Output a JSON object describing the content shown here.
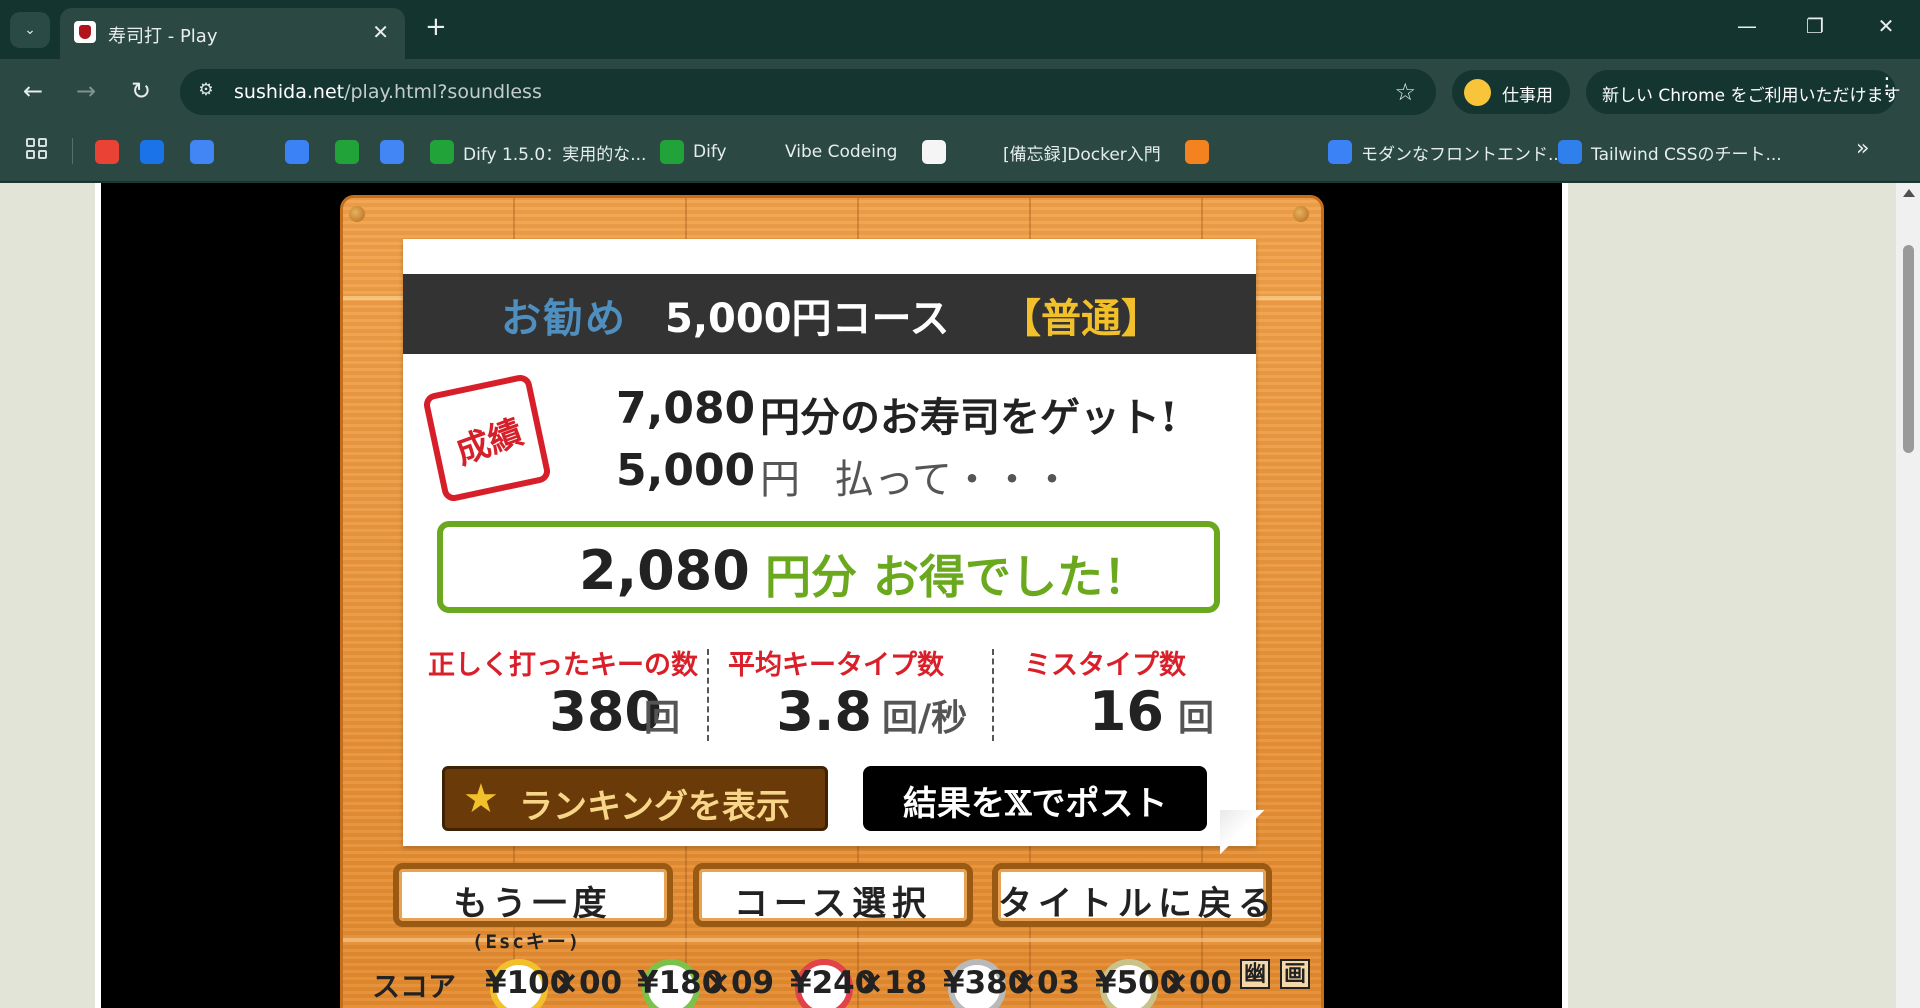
{
  "browser": {
    "tab_title": "寿司打 - Play",
    "url_host": "sushida.net",
    "url_rest": "/play.html?soundless",
    "profile_label": "仕事用",
    "chrome_promo": "新しい Chrome をご利用いただけます",
    "colors": {
      "frame": "#143430",
      "toolbar": "#2b4843"
    }
  },
  "bookmarks": [
    {
      "label": "",
      "icon": "gmail-icon",
      "color": "#ea4335"
    },
    {
      "label": "",
      "icon": "if-icon",
      "color": "#1a73e8"
    },
    {
      "label": "",
      "icon": "docs-icon",
      "color": "#4285f4"
    },
    {
      "label": "",
      "icon": "chatgpt-icon",
      "color": "#2b4843"
    },
    {
      "label": "",
      "icon": "slash-icon",
      "color": "#3b82f6"
    },
    {
      "label": "",
      "icon": "dify-icon",
      "color": "#22a33a"
    },
    {
      "label": "",
      "icon": "calendar-icon",
      "color": "#4285f4"
    },
    {
      "label": "Dify 1.5.0：実用的な...",
      "icon": "dify-icon",
      "color": "#22a33a"
    },
    {
      "label": "Dify",
      "icon": "dify-icon",
      "color": "#22a33a"
    },
    {
      "label": "Vibe Codeing",
      "icon": "folder-icon",
      "color": "#2b4843"
    },
    {
      "label": "",
      "icon": "anthropic-icon",
      "color": "#f5f5f5"
    },
    {
      "label": "[備忘録]Docker入門",
      "icon": "globe-icon",
      "color": "#2b4843"
    },
    {
      "label": "",
      "icon": "box-icon",
      "color": "#f58220"
    },
    {
      "label": "",
      "icon": "github-icon",
      "color": "#2b4843"
    },
    {
      "label": "",
      "icon": "sparkle-icon",
      "color": "#2b4843"
    },
    {
      "label": "モダンなフロントエンド...",
      "icon": "slash-icon",
      "color": "#3b82f6"
    },
    {
      "label": "Tailwind CSSのチート...",
      "icon": "code-icon",
      "color": "#2f80ed"
    }
  ],
  "game": {
    "course": {
      "recommend": "お勧め",
      "name": "5,000円コース",
      "level": "【普通】"
    },
    "stamp": "成績",
    "result": {
      "got_amount": "7,080",
      "got_text": "円分のお寿司をゲット!",
      "paid_amount": "5,000",
      "paid_yen": "円",
      "paid_text": "払って・・・",
      "gain_amount": "2,080",
      "gain_text": "円分 お得でした！"
    },
    "stats": [
      {
        "label": "正しく打ったキーの数",
        "value": "380",
        "unit": "回"
      },
      {
        "label": "平均キータイプ数",
        "value": "3.8",
        "unit": "回/秒"
      },
      {
        "label": "ミスタイプ数",
        "value": "16",
        "unit": "回"
      }
    ],
    "ranking_button": "ランキングを表示",
    "post_button": "結果を𝕏でポスト",
    "buttons": {
      "retry": "もう一度",
      "course_select": "コース選択",
      "back_to_title": "タイトルに戻る"
    },
    "esc_hint": "(Escキー)",
    "score": {
      "label": "スコア",
      "plates": [
        {
          "price": "¥100",
          "count": "×00",
          "color": "#f2c02a"
        },
        {
          "price": "¥180",
          "count": "×09",
          "color": "#7cc24a"
        },
        {
          "price": "¥240",
          "count": "×18",
          "color": "#e2424a"
        },
        {
          "price": "¥380",
          "count": "×03",
          "color": "#b9b9b9"
        },
        {
          "price": "¥500",
          "count": "×00",
          "color": "#c9c28a"
        }
      ],
      "kanji_left": "幽",
      "kanji_right": "画"
    }
  }
}
